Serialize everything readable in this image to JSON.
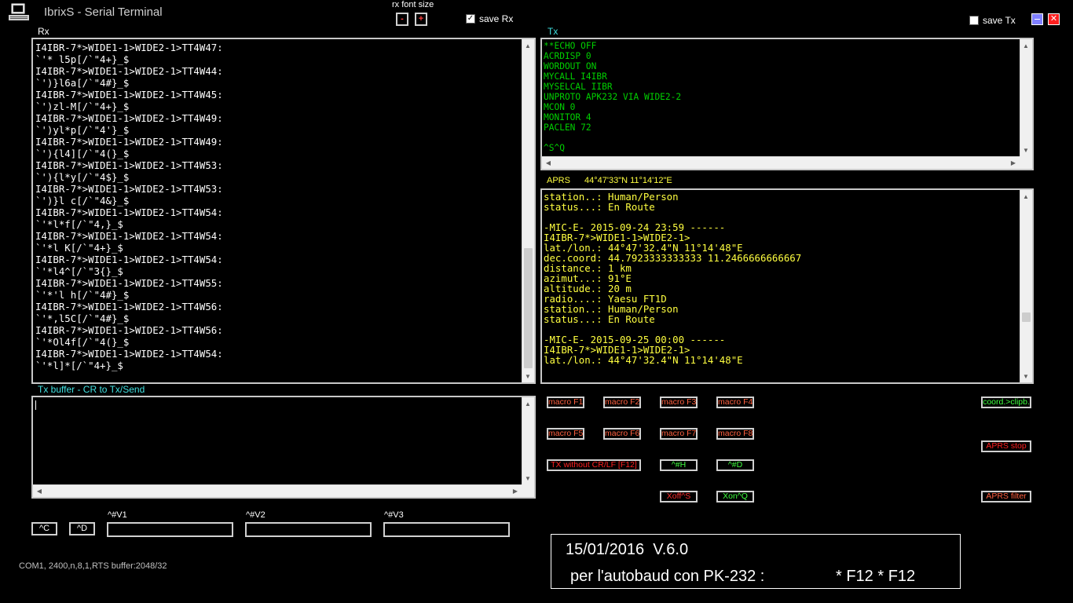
{
  "app": {
    "title": "IbrixS - Serial Terminal"
  },
  "header": {
    "rx_font_size_label": "rx font size",
    "font_minus": "-",
    "font_plus": "+",
    "save_rx_label": "save Rx",
    "save_rx_checked": true,
    "save_tx_label": "save Tx",
    "save_tx_checked": false
  },
  "rx": {
    "label": "Rx",
    "text": "I4IBR-7*>WIDE1-1>WIDE2-1>TT4W47:\n`'* l5p[/`\"4+}_$\nI4IBR-7*>WIDE1-1>WIDE2-1>TT4W44:\n`')}l6a[/`\"4#}_$\nI4IBR-7*>WIDE1-1>WIDE2-1>TT4W45:\n`')zl-M[/`\"4+}_$\nI4IBR-7*>WIDE1-1>WIDE2-1>TT4W49:\n`')yl*p[/`\"4'}_$\nI4IBR-7*>WIDE1-1>WIDE2-1>TT4W49:\n`'){l4][/`\"4(}_$\nI4IBR-7*>WIDE1-1>WIDE2-1>TT4W53:\n`'){l*y[/`\"4$}_$\nI4IBR-7*>WIDE1-1>WIDE2-1>TT4W53:\n`')}l c[/`\"4&}_$\nI4IBR-7*>WIDE1-1>WIDE2-1>TT4W54:\n`'*l*f[/`\"4,}_$\nI4IBR-7*>WIDE1-1>WIDE2-1>TT4W54:\n`'*l K[/`\"4+}_$\nI4IBR-7*>WIDE1-1>WIDE2-1>TT4W54:\n`'*l4^[/`\"3{}_$\nI4IBR-7*>WIDE1-1>WIDE2-1>TT4W55:\n`'*'l h[/`\"4#}_$\nI4IBR-7*>WIDE1-1>WIDE2-1>TT4W56:\n`'*,l5C[/`\"4#}_$\nI4IBR-7*>WIDE1-1>WIDE2-1>TT4W56:\n`'*Ol4f[/`\"4(}_$\nI4IBR-7*>WIDE1-1>WIDE2-1>TT4W54:\n`'*l]*[/`\"4+}_$"
  },
  "tx": {
    "label": "Tx",
    "text": "**ECHO OFF\nACRDISP 0\nWORDOUT ON\nMYCALL I4IBR\nMYSELCAL IIBR\nUNPROTO APK232 VIA WIDE2-2\nMCON 0\nMONITOR 4\nPACLEN 72\n\n^S^Q"
  },
  "aprs": {
    "label": "APRS",
    "coords": "44°47'33\"N  11°14'12\"E",
    "text": "station..: Human/Person\nstatus...: En Route\n\n-MIC-E- 2015-09-24 23:59 ------\nI4IBR-7*>WIDE1-1>WIDE2-1>\nlat./lon.: 44°47'32.4\"N 11°14'48\"E\ndec.coord: 44.7923333333333 11.2466666666667\ndistance.: 1 km\nazimut...: 91°E\naltitude.: 20 m\nradio....: Yaesu FT1D\nstation..: Human/Person\nstatus...: En Route\n\n-MIC-E- 2015-09-25 00:00 ------\nI4IBR-7*>WIDE1-1>WIDE2-1>\nlat./lon.: 44°47'32.4\"N 11°14'48\"E"
  },
  "txbuffer": {
    "label": "Tx buffer - CR to Tx/Send",
    "value": ""
  },
  "macros": {
    "f1": "macro F1",
    "f2": "macro F2",
    "f3": "macro F3",
    "f4": "macro F4",
    "f5": "macro F5",
    "f6": "macro F6",
    "f7": "macro F7",
    "f8": "macro F8",
    "tx_no_crlf": "TX without CR/LF [F12]",
    "ctrl_h": "^#H",
    "ctrl_d": "^#D",
    "xoff": "Xoff^S",
    "xon": "Xon^Q"
  },
  "right_buttons": {
    "coord_clip": "coord.>clipb.",
    "aprs_stop": "APRS stop",
    "aprs_filter": "APRS filter"
  },
  "ctrl_buttons": {
    "ctrl_c": "^C",
    "ctrl_d": "^D"
  },
  "vfields": [
    {
      "label": "^#V1",
      "value": ""
    },
    {
      "label": "^#V2",
      "value": ""
    },
    {
      "label": "^#V3",
      "value": ""
    }
  ],
  "status": {
    "text": "COM1, 2400,n,8,1,RTS  buffer:2048/32"
  },
  "info": {
    "line1": "15/01/2016  V.6.0",
    "line2": "per l'autobaud con PK-232 :",
    "line3": "* F12 * F12"
  },
  "colors": {
    "rx_text": "#ffffff",
    "tx_text": "#00d000",
    "aprs_text": "#ffff40",
    "cyan": "#40e0e0",
    "macro_text": "#ff6040"
  }
}
